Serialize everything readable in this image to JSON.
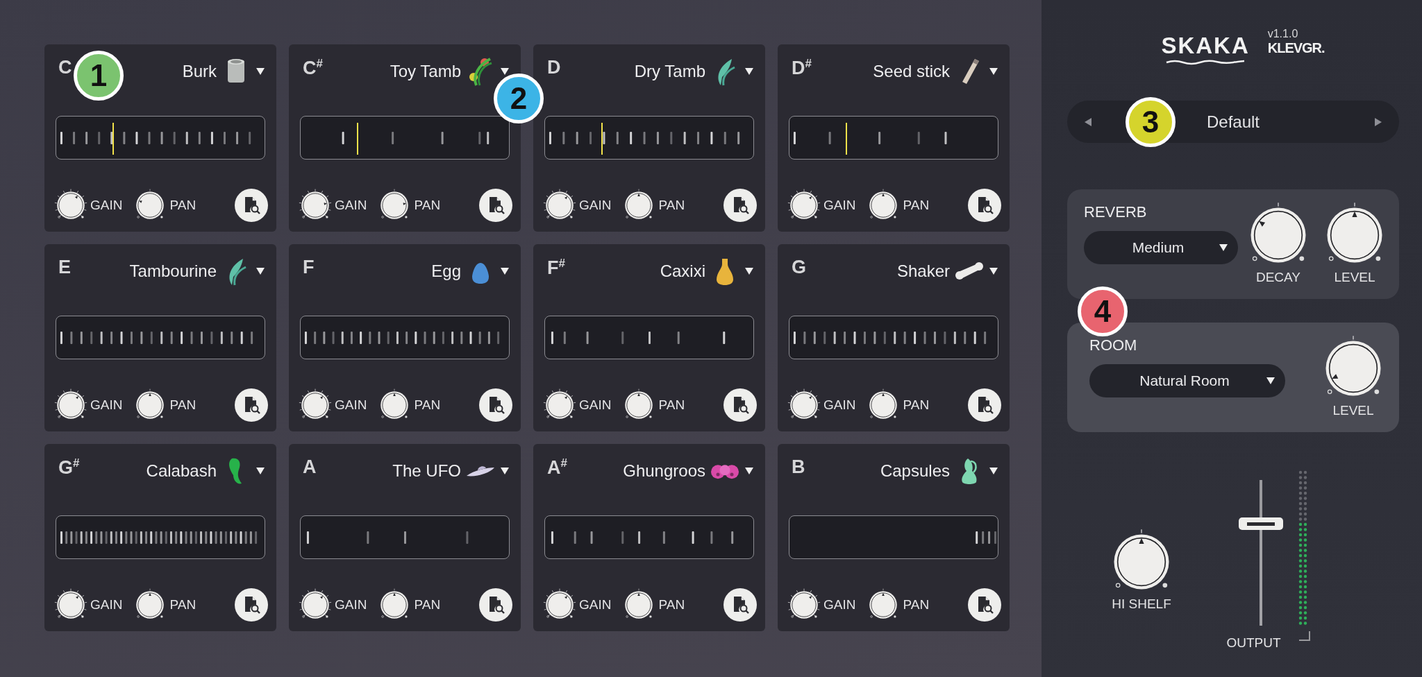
{
  "pads": [
    {
      "note": "C",
      "instrument": "Burk",
      "playhead": {
        "level": 0.27
      },
      "gain": {
        "label": "GAIN",
        "level": 0.63
      },
      "pan": {
        "label": "PAN",
        "level": 0.25
      }
    },
    {
      "note": "C$^{#}$",
      "instrument": "Toy Tamb",
      "playhead": {
        "level": 0.27
      },
      "gain": {
        "label": "GAIN",
        "level": 0.8
      },
      "pan": {
        "label": "PAN",
        "level": 0.8
      }
    },
    {
      "note": "D",
      "instrument": "Dry Tamb",
      "playhead": {
        "level": 0.27
      },
      "gain": {
        "label": "GAIN",
        "level": 0.65
      },
      "pan": {
        "label": "PAN",
        "level": 0.5
      }
    },
    {
      "note": "D$^{#}$",
      "instrument": "Seed stick",
      "playhead": {
        "level": 0.27
      },
      "gain": {
        "label": "GAIN",
        "level": 0.65
      },
      "pan": {
        "label": "PAN",
        "level": 0.5
      }
    },
    {
      "note": "E",
      "instrument": "Tambourine",
      "gain": {
        "label": "GAIN",
        "level": 0.65
      },
      "pan": {
        "label": "PAN",
        "level": 0.5
      }
    },
    {
      "note": "F",
      "instrument": "Egg",
      "gain": {
        "label": "GAIN",
        "level": 0.65
      },
      "pan": {
        "label": "PAN",
        "level": 0.5
      }
    },
    {
      "note": "F$^{#}$",
      "instrument": "Caxixi",
      "gain": {
        "label": "GAIN",
        "level": 0.65
      },
      "pan": {
        "label": "PAN",
        "level": 0.5
      }
    },
    {
      "note": "G",
      "instrument": "Shaker",
      "gain": {
        "label": "GAIN",
        "level": 0.65
      },
      "pan": {
        "label": "PAN",
        "level": 0.5
      }
    },
    {
      "note": "G$^{#}$",
      "instrument": "Calabash",
      "gain": {
        "label": "GAIN",
        "level": 0.65
      },
      "pan": {
        "label": "PAN",
        "level": 0.5
      }
    },
    {
      "note": "A",
      "instrument": "The UFO",
      "gain": {
        "label": "GAIN",
        "level": 0.65
      },
      "pan": {
        "label": "PAN",
        "level": 0.5
      }
    },
    {
      "note": "A$^{#}$",
      "instrument": "Ghungroos",
      "gain": {
        "label": "GAIN",
        "level": 0.65
      },
      "pan": {
        "label": "PAN",
        "level": 0.5
      }
    },
    {
      "note": "B",
      "instrument": "Capsules",
      "gain": {
        "label": "GAIN",
        "level": 0.65
      },
      "pan": {
        "label": "PAN",
        "level": 0.5
      }
    }
  ],
  "logo": {
    "name": "SKAKA",
    "version": "v1.1.0",
    "maker": "KLEVGR."
  },
  "preset": {
    "name": "Default"
  },
  "reverb": {
    "title": "REVERB",
    "type": "Medium",
    "knobs": [
      {
        "label": "DECAY",
        "level": 0.3
      },
      {
        "label": "LEVEL",
        "level": 0.5
      }
    ]
  },
  "room": {
    "title": "ROOM",
    "type": "Natural Room",
    "knobs": [
      {
        "label": "LEVEL",
        "level": 0.07
      }
    ]
  },
  "hi_shelf": {
    "label": "HI SHELF",
    "level": 0.5
  },
  "output": {
    "label": "OUTPUT",
    "level": 0.7,
    "meter": {
      "level": 0.68
    }
  },
  "callouts": [
    {
      "label": "1",
      "color": "#7bc36f"
    },
    {
      "label": "2",
      "color": "#3cb4e6"
    },
    {
      "label": "3",
      "color": "#d5d42c"
    },
    {
      "label": "4",
      "color": "#e8646f"
    }
  ]
}
